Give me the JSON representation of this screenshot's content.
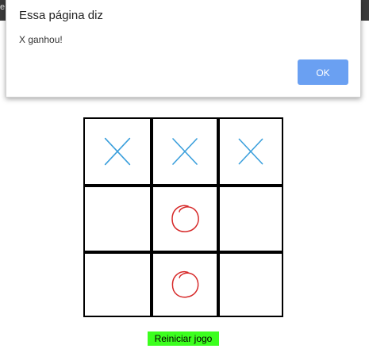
{
  "browser": {
    "edge_text": "e"
  },
  "dialog": {
    "title": "Essa página diz",
    "message": "X ganhou!",
    "ok_label": "OK",
    "ok_color": "#6aa0f2"
  },
  "board": {
    "cells": [
      "X",
      "X",
      "X",
      "",
      "O",
      "",
      "",
      "O",
      ""
    ],
    "x_color": "#3a9fdc",
    "o_color": "#d62828"
  },
  "restart": {
    "label": "Reiniciar jogo",
    "color": "#3cff1e"
  }
}
